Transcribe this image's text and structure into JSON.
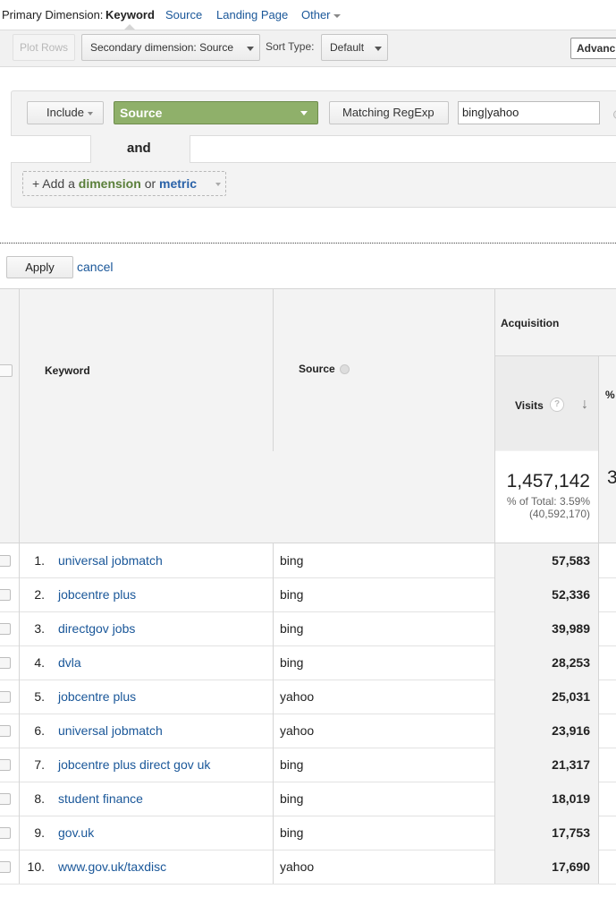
{
  "dimension_bar": {
    "label": "Primary Dimension:",
    "active": "Keyword",
    "options": [
      "Source",
      "Landing Page",
      "Other"
    ]
  },
  "toolbar": {
    "plot_rows": "Plot Rows",
    "secondary_dimension": "Secondary dimension: Source",
    "sort_label": "Sort Type:",
    "sort_value": "Default",
    "advanced": "Advanc"
  },
  "filter": {
    "include": "Include",
    "dimension": "Source",
    "match_type": "Matching RegExp",
    "expression": "bing|yahoo",
    "and_label": "and",
    "add_prefix": "+ Add a",
    "add_dimension": "dimension",
    "add_or": "or",
    "add_metric": "metric",
    "apply": "Apply",
    "cancel": "cancel"
  },
  "table": {
    "headers": {
      "keyword": "Keyword",
      "source": "Source",
      "acquisition": "Acquisition",
      "visits": "Visits",
      "help": "?",
      "sort_arrow": "↓",
      "pct": "%"
    },
    "totals": {
      "visits": "1,457,142",
      "pct_of_total": "% of Total: 3.59%",
      "of": "(40,592,170)",
      "pct_cut": "3"
    },
    "rows": [
      {
        "idx": "1.",
        "keyword": "universal jobmatch",
        "source": "bing",
        "visits": "57,583"
      },
      {
        "idx": "2.",
        "keyword": "jobcentre plus",
        "source": "bing",
        "visits": "52,336"
      },
      {
        "idx": "3.",
        "keyword": "directgov jobs",
        "source": "bing",
        "visits": "39,989"
      },
      {
        "idx": "4.",
        "keyword": "dvla",
        "source": "bing",
        "visits": "28,253"
      },
      {
        "idx": "5.",
        "keyword": "jobcentre plus",
        "source": "yahoo",
        "visits": "25,031"
      },
      {
        "idx": "6.",
        "keyword": "universal jobmatch",
        "source": "yahoo",
        "visits": "23,916"
      },
      {
        "idx": "7.",
        "keyword": "jobcentre plus direct gov uk",
        "source": "bing",
        "visits": "21,317"
      },
      {
        "idx": "8.",
        "keyword": "student finance",
        "source": "bing",
        "visits": "18,019"
      },
      {
        "idx": "9.",
        "keyword": "gov.uk",
        "source": "bing",
        "visits": "17,753"
      },
      {
        "idx": "10.",
        "keyword": "www.gov.uk/taxdisc",
        "source": "yahoo",
        "visits": "17,690"
      }
    ]
  }
}
